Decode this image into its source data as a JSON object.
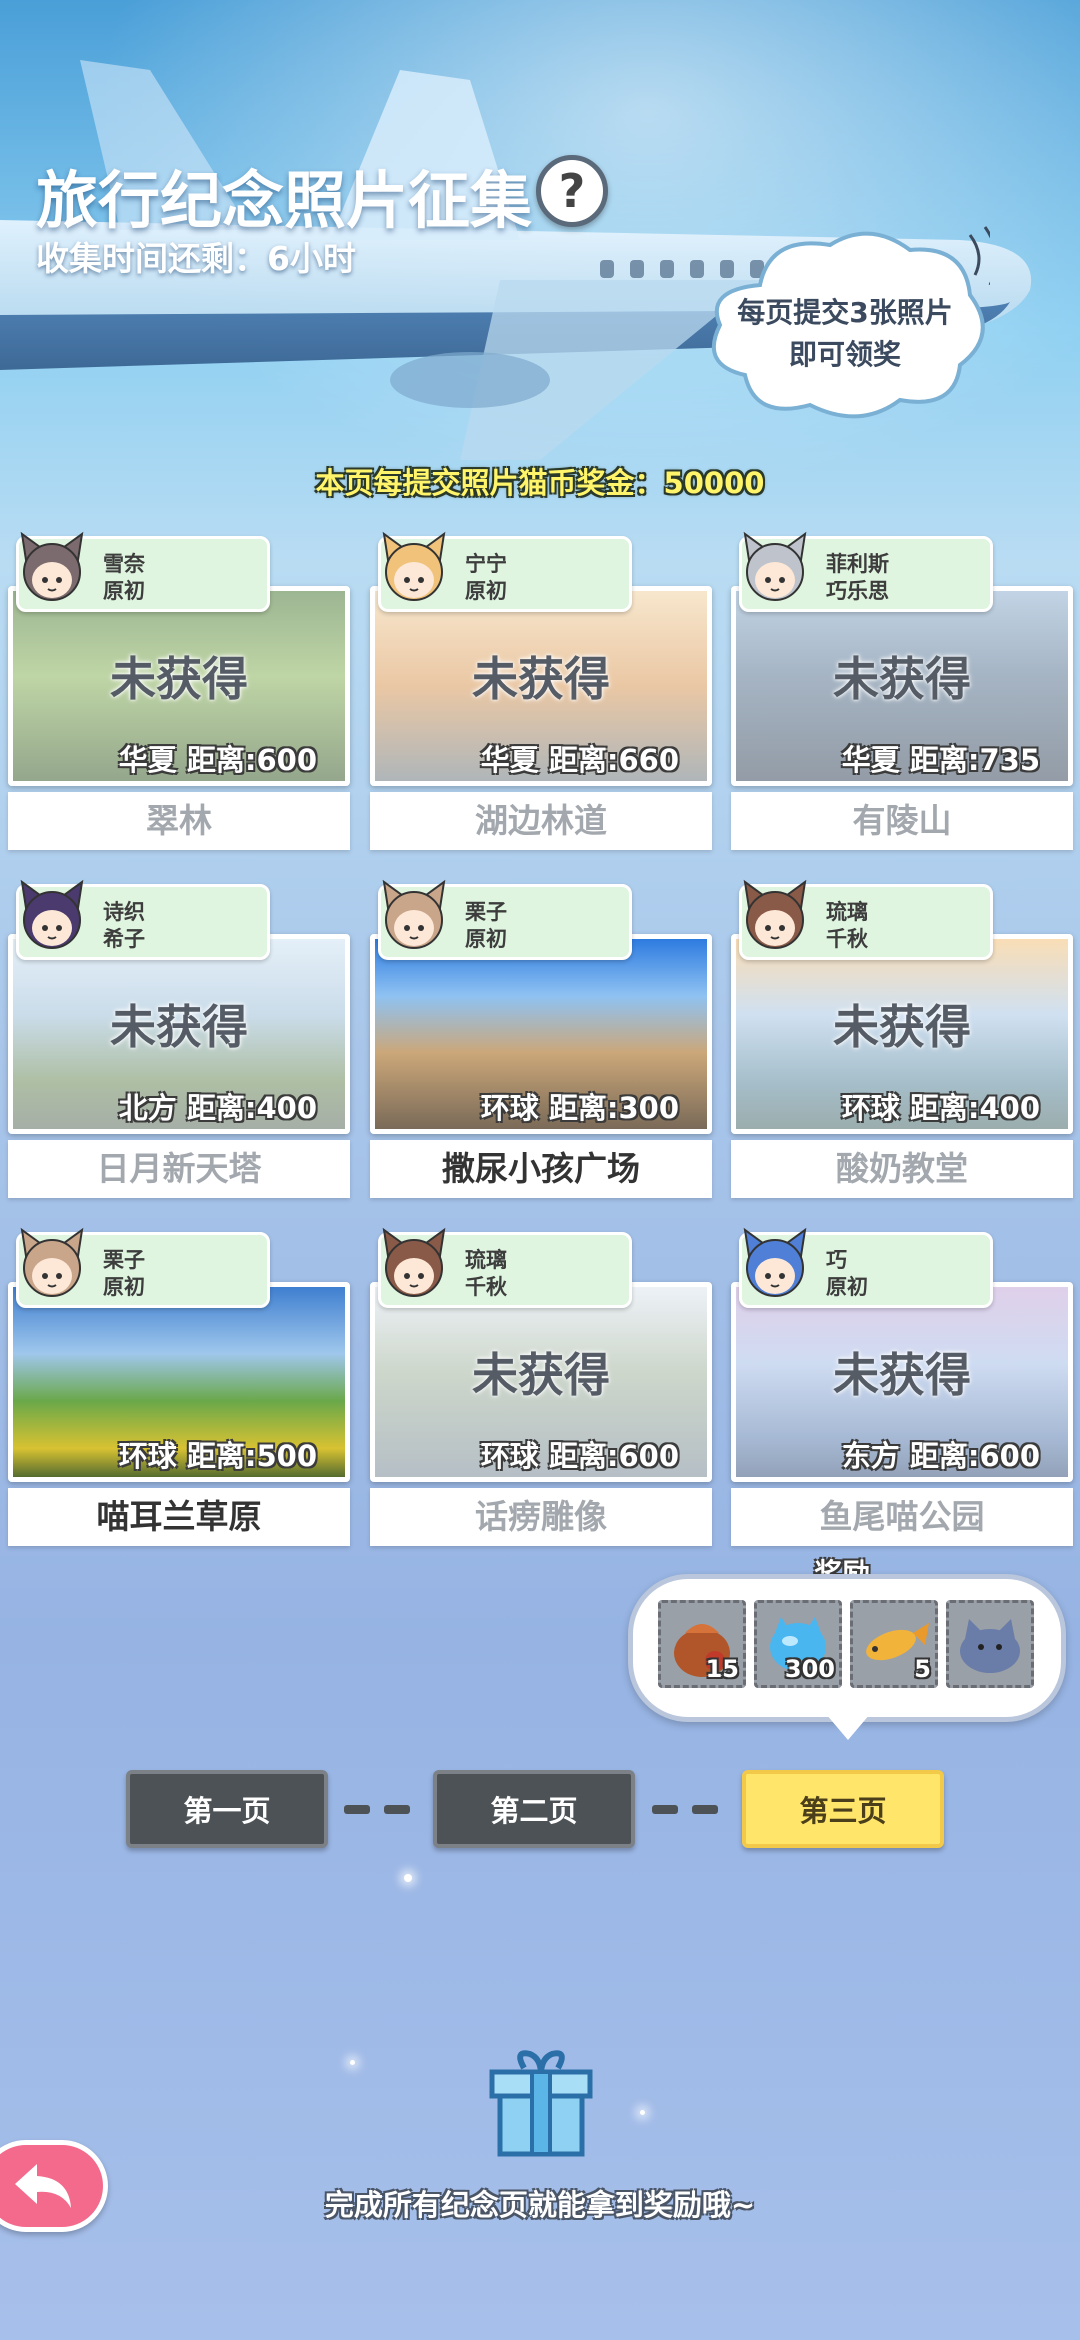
{
  "header": {
    "title": "旅行纪念照片征集",
    "help_icon": "?",
    "timer": "收集时间还剩：6小时",
    "cloud_tip": [
      "每页提交3张照片",
      "即可领奖"
    ],
    "bonus": "本页每提交照片猫币奖金：50000"
  },
  "cards": [
    {
      "char1": "雪奈",
      "char2": "原初",
      "status": "未获得",
      "dist": "华夏  距离:600",
      "name": "翠林",
      "obtained": false
    },
    {
      "char1": "宁宁",
      "char2": "原初",
      "status": "未获得",
      "dist": "华夏  距离:660",
      "name": "湖边林道",
      "obtained": false
    },
    {
      "char1": "菲利斯",
      "char2": "巧乐思",
      "status": "未获得",
      "dist": "华夏  距离:735",
      "name": "有陵山",
      "obtained": false
    },
    {
      "char1": "诗织",
      "char2": "希子",
      "status": "未获得",
      "dist": "北方  距离:400",
      "name": "日月新天塔",
      "obtained": false
    },
    {
      "char1": "栗子",
      "char2": "原初",
      "status": "",
      "dist": "环球  距离:300",
      "name": "撒尿小孩广场",
      "obtained": true
    },
    {
      "char1": "琉璃",
      "char2": "千秋",
      "status": "未获得",
      "dist": "环球  距离:400",
      "name": "酸奶教堂",
      "obtained": false
    },
    {
      "char1": "栗子",
      "char2": "原初",
      "status": "",
      "dist": "环球  距离:500",
      "name": "喵耳兰草原",
      "obtained": true
    },
    {
      "char1": "琉璃",
      "char2": "千秋",
      "status": "未获得",
      "dist": "环球  距离:600",
      "name": "话痨雕像",
      "obtained": false
    },
    {
      "char1": "巧",
      "char2": "原初",
      "status": "未获得",
      "dist": "东方  距离:600",
      "name": "鱼尾喵公园",
      "obtained": false
    }
  ],
  "reward": {
    "label": "奖励",
    "items": [
      {
        "icon": "treasure-bag-icon",
        "count": "15"
      },
      {
        "icon": "blue-cat-crystal-icon",
        "count": "300"
      },
      {
        "icon": "fish-icon",
        "count": "5"
      },
      {
        "icon": "cat-plush-icon",
        "count": ""
      }
    ]
  },
  "pager": {
    "page1": "第一页",
    "page2": "第二页",
    "page3": "第三页",
    "active_page": 3
  },
  "footer": {
    "text": "完成所有纪念页就能拿到奖励哦~"
  },
  "colors": {
    "active_page": "#ffe56a",
    "inactive_page": "#4d5256",
    "back_button": "#f36a8c",
    "tag_bg": "#dff5e0"
  }
}
